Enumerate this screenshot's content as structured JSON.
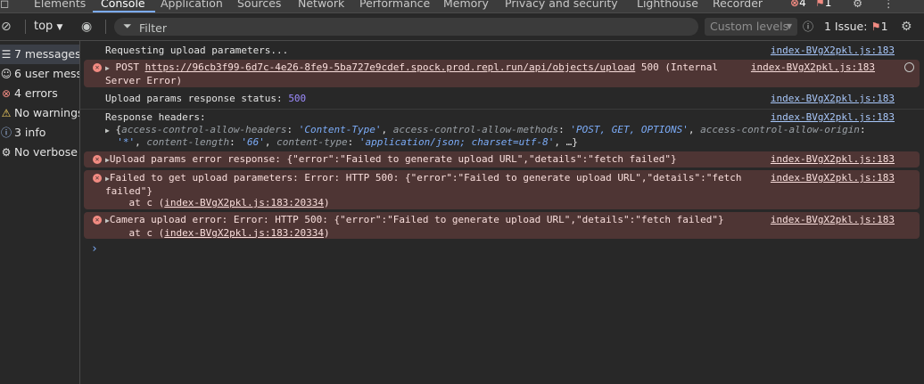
{
  "tabs": [
    "Elements",
    "Console",
    "Application",
    "Sources",
    "Network",
    "Performance",
    "Memory",
    "Privacy and security",
    "Lighthouse",
    "Recorder"
  ],
  "tab_badges": {
    "errors": "4",
    "warnings": "1"
  },
  "toolbar": {
    "context": "top",
    "filter_placeholder": "Filter",
    "levels": "Custom levels",
    "issues_label": "1 Issue:",
    "issues_count": "1"
  },
  "sidebar": {
    "items": [
      {
        "icon": "list-icon",
        "label": "7 messages"
      },
      {
        "icon": "user-icon",
        "label": "6 user messages"
      },
      {
        "icon": "error-icon",
        "label": "4 errors"
      },
      {
        "icon": "warning-icon",
        "label": "No warnings"
      },
      {
        "icon": "info-icon",
        "label": "3 info"
      },
      {
        "icon": "verbose-icon",
        "label": "No verbose"
      }
    ]
  },
  "console": {
    "source": "index-BVgX2pkl.js:183",
    "m1": "Requesting upload parameters...",
    "m2_method": "POST",
    "m2_url": "https://96cb3f99-6d7c-4e26-8fe9-5ba727e9cdef.spock.prod.repl.run/api/objects/upload",
    "m2_status": " 500 (Internal",
    "m2_status2": "Server Error)",
    "m3_text": "Upload params response status: ",
    "m3_value": "500",
    "m4_title": "Response headers:",
    "m4_k1": "access-control-allow-headers",
    "m4_v1": "'Content-Type'",
    "m4_k2": "access-control-allow-methods",
    "m4_v2": "'POST, GET, OPTIONS'",
    "m4_k3": "access-control-allow-origin",
    "m4_v3": "'*'",
    "m4_k4": "content-length",
    "m4_v4": "'66'",
    "m4_k5": "content-type",
    "m4_v5": "'application/json; charset=utf-8'",
    "m5": "Upload params error response: {\"error\":\"Failed to generate upload URL\",\"details\":\"fetch failed\"}",
    "m6_l1": "Failed to get upload parameters: Error: HTTP 500: {\"error\":\"Failed to generate upload URL\",\"details\":\"fetch",
    "m6_l2": "failed\"}",
    "at_prefix": "    at c (",
    "at_link": "index-BVgX2pkl.js:183:20334",
    "at_suffix": ")",
    "m7": "Camera upload error: Error: HTTP 500: {\"error\":\"Failed to generate upload URL\",\"details\":\"fetch failed\"}"
  }
}
